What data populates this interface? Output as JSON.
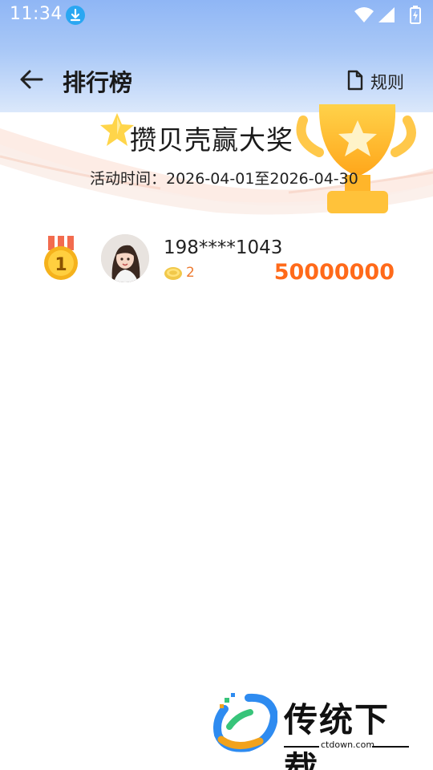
{
  "status_bar": {
    "time": "11:34",
    "icons": [
      "download-icon",
      "wifi-icon",
      "signal-icon",
      "battery-charging-icon"
    ]
  },
  "header": {
    "back_icon": "arrow-left-icon",
    "title": "排行榜",
    "rules_icon": "document-icon",
    "rules_label": "规则"
  },
  "banner": {
    "title": "攒贝壳赢大奖",
    "period": "活动时间：2026-04-01至2026-04-30"
  },
  "leaderboard": [
    {
      "rank": "1",
      "rank_icon": "gold-medal-icon",
      "avatar": "avatar",
      "user": "198****1043",
      "coins": "2",
      "score": "50000000"
    }
  ],
  "watermark": {
    "brand": "传统下载",
    "url": "ctdown.com"
  },
  "colors": {
    "accent": "#ff6a1a",
    "header_bg": "#a9c8f7",
    "coin": "#ee7a30"
  }
}
